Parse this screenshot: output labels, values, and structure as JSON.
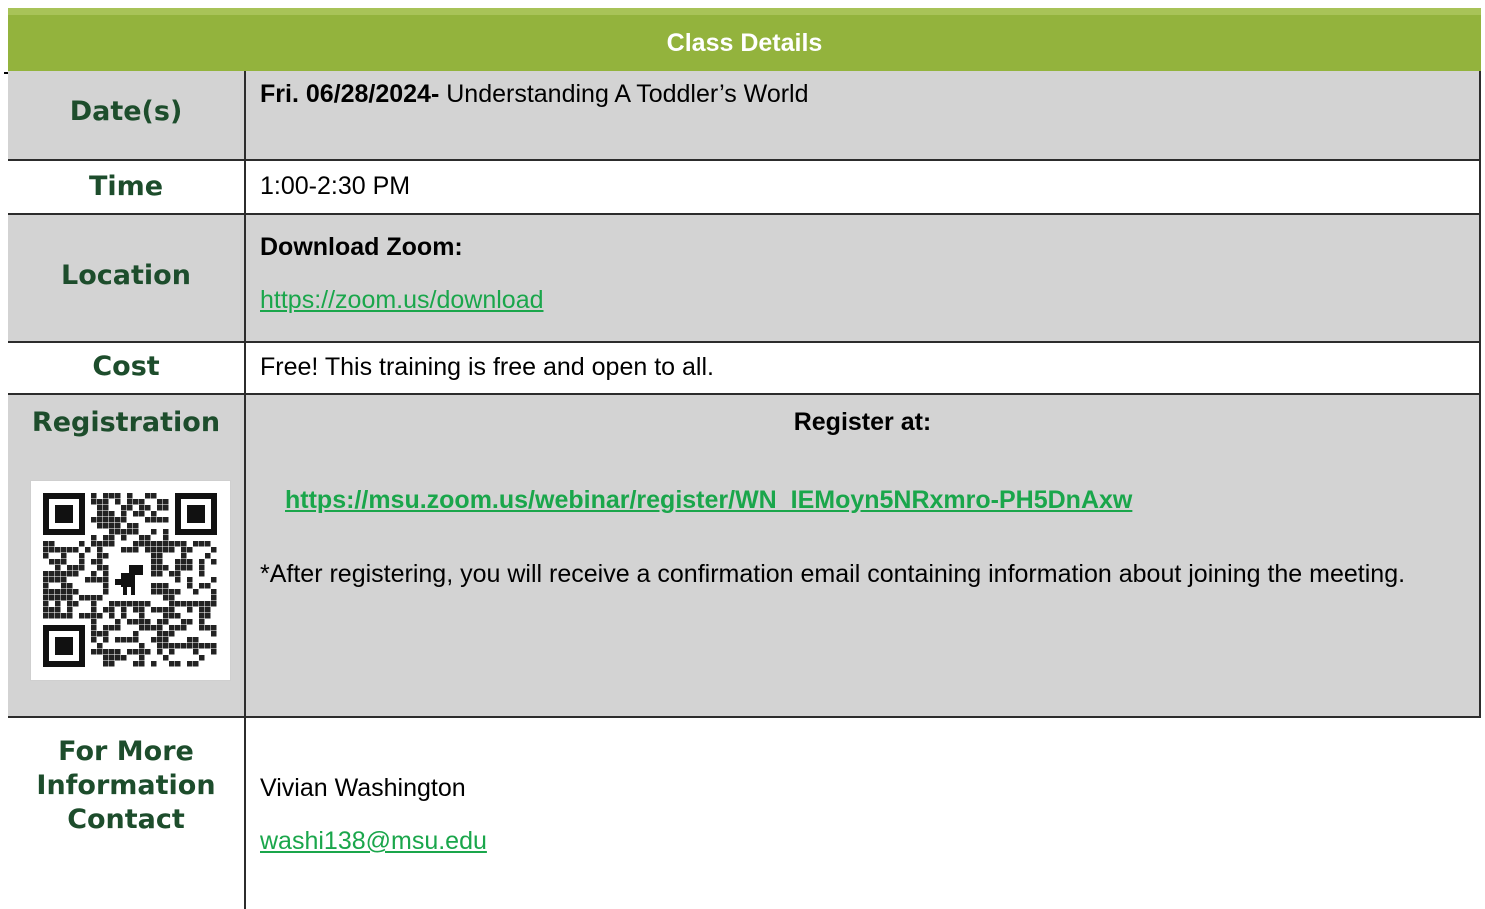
{
  "header": {
    "title": "Class Details"
  },
  "rows": {
    "dates": {
      "label": "Date(s)",
      "date_bold": "Fri.  06/28/2024-",
      "title": " Understanding A Toddler’s World"
    },
    "time": {
      "label": "Time",
      "value": "1:00-2:30 PM"
    },
    "location": {
      "label": "Location",
      "heading": "Download Zoom:",
      "link": "https://zoom.us/download"
    },
    "cost": {
      "label": "Cost",
      "value": "Free! This training is free and open to all."
    },
    "registration": {
      "label": "Registration",
      "heading": "Register at:",
      "link": "https://msu.zoom.us/webinar/register/WN_IEMoyn5NRxmro-PH5DnAxw",
      "note": "*After registering, you will receive a confirmation email containing information about joining the meeting."
    },
    "contact": {
      "label_line1": "For More",
      "label_line2": "Information",
      "label_line3": "Contact",
      "name": "Vivian Washington",
      "email": "washi138@msu.edu"
    }
  },
  "colors": {
    "header_green": "#93b33d",
    "label_green": "#1d4d2c",
    "link_green": "#1aa64b",
    "row_gray": "#d3d3d3"
  },
  "icons": {
    "qr": "qr-code-icon"
  }
}
